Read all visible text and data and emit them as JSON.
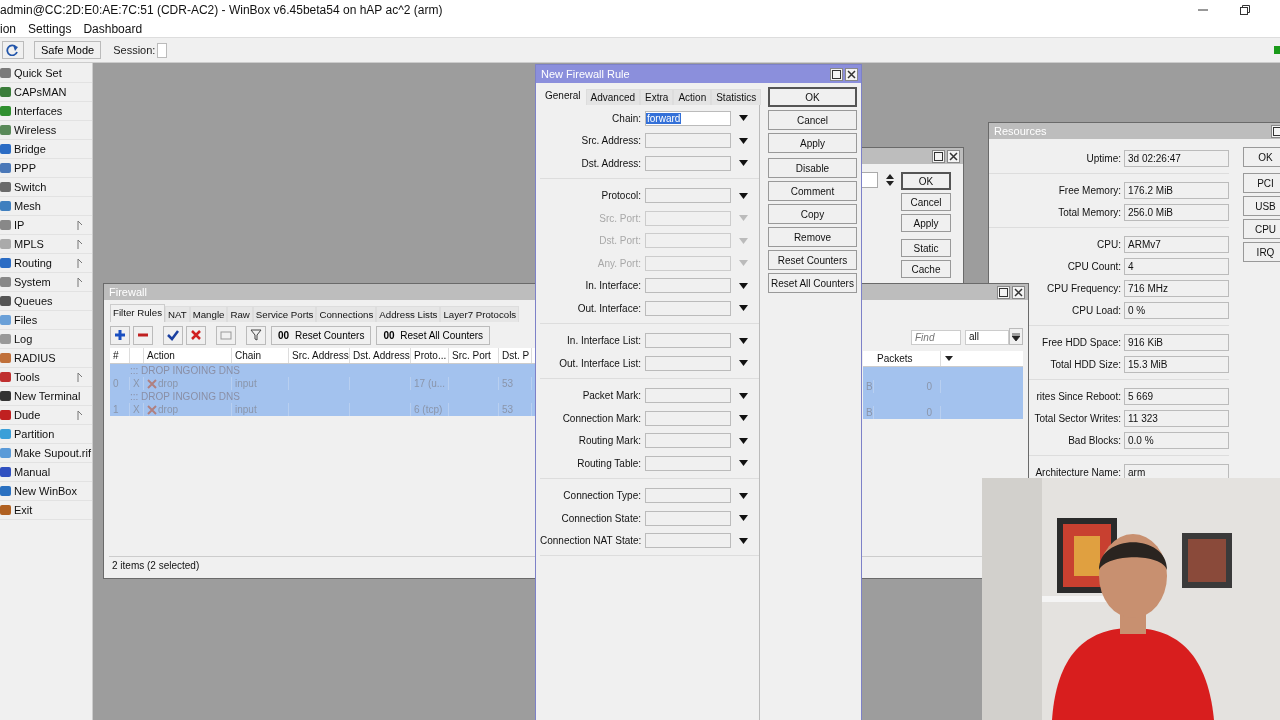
{
  "window": {
    "title": "admin@CC:2D:E0:AE:7C:51 (CDR-AC2) - WinBox v6.45beta54 on hAP ac^2 (arm)"
  },
  "menu": [
    "ion",
    "Settings",
    "Dashboard"
  ],
  "toolbar": {
    "safe_mode": "Safe Mode",
    "session_label": "Session:"
  },
  "sidebar": {
    "items": [
      {
        "label": "Quick Set",
        "submenu": false
      },
      {
        "label": "CAPsMAN",
        "submenu": false
      },
      {
        "label": "Interfaces",
        "submenu": false
      },
      {
        "label": "Wireless",
        "submenu": false
      },
      {
        "label": "Bridge",
        "submenu": false
      },
      {
        "label": "PPP",
        "submenu": false
      },
      {
        "label": "Switch",
        "submenu": false
      },
      {
        "label": "Mesh",
        "submenu": false
      },
      {
        "label": "IP",
        "submenu": true
      },
      {
        "label": "MPLS",
        "submenu": true
      },
      {
        "label": "Routing",
        "submenu": true
      },
      {
        "label": "System",
        "submenu": true
      },
      {
        "label": "Queues",
        "submenu": false
      },
      {
        "label": "Files",
        "submenu": false
      },
      {
        "label": "Log",
        "submenu": false
      },
      {
        "label": "RADIUS",
        "submenu": false
      },
      {
        "label": "Tools",
        "submenu": true
      },
      {
        "label": "New Terminal",
        "submenu": false
      },
      {
        "label": "Dude",
        "submenu": true
      },
      {
        "label": "Partition",
        "submenu": false
      },
      {
        "label": "Make Supout.rif",
        "submenu": false
      },
      {
        "label": "Manual",
        "submenu": false
      },
      {
        "label": "New WinBox",
        "submenu": false
      },
      {
        "label": "Exit",
        "submenu": false
      }
    ]
  },
  "back_window": {
    "buttons": [
      "OK",
      "Cancel",
      "Apply",
      "Static",
      "Cache"
    ]
  },
  "firewall": {
    "title": "Firewall",
    "tabs": [
      {
        "label": "Filter Rules",
        "selected": true
      },
      {
        "label": "NAT",
        "selected": false
      },
      {
        "label": "Mangle",
        "selected": false
      },
      {
        "label": "Raw",
        "selected": false
      },
      {
        "label": "Service Ports",
        "selected": false
      },
      {
        "label": "Connections",
        "selected": false
      },
      {
        "label": "Address Lists",
        "selected": false
      },
      {
        "label": "Layer7 Protocols",
        "selected": false
      }
    ],
    "counter_buttons": [
      {
        "glyph": "00",
        "label": "Reset Counters"
      },
      {
        "glyph": "00",
        "label": "Reset All Counters"
      }
    ],
    "columns": [
      "#",
      "Action",
      "Chain",
      "Src. Address",
      "Dst. Address",
      "Proto...",
      "Src. Port",
      "Dst. P"
    ],
    "find": {
      "placeholder": "Find"
    },
    "filter": "all",
    "right_columns": [
      "Packets"
    ],
    "rows": [
      {
        "kind": "comment",
        "text": "::: DROP INGOING DNS",
        "selected": true
      },
      {
        "kind": "rule",
        "number": "0",
        "flag": "X",
        "action": "drop",
        "chain": "input",
        "protocol": "17 (u...",
        "dst_port": "53",
        "bytes": "B",
        "packets": "0",
        "disabled": true,
        "selected": true
      },
      {
        "kind": "comment",
        "text": "::: DROP INGOING DNS",
        "selected": true
      },
      {
        "kind": "rule",
        "number": "1",
        "flag": "X",
        "action": "drop",
        "chain": "input",
        "protocol": "6 (tcp)",
        "dst_port": "53",
        "bytes": "B",
        "packets": "0",
        "disabled": true,
        "selected": true
      }
    ],
    "status": "2 items (2 selected)"
  },
  "dialog": {
    "title": "New Firewall Rule",
    "tabs": [
      {
        "label": "General",
        "selected": true
      },
      {
        "label": "Advanced",
        "selected": false
      },
      {
        "label": "Extra",
        "selected": false
      },
      {
        "label": "Action",
        "selected": false
      },
      {
        "label": "Statistics",
        "selected": false
      }
    ],
    "groups": [
      [
        {
          "label": "Chain:",
          "value": "forward",
          "value_selected": true,
          "disabled": false
        },
        {
          "label": "Src. Address:",
          "disabled": false
        },
        {
          "label": "Dst. Address:",
          "disabled": false
        }
      ],
      [
        {
          "label": "Protocol:",
          "disabled": false
        },
        {
          "label": "Src. Port:",
          "disabled": true
        },
        {
          "label": "Dst. Port:",
          "disabled": true
        },
        {
          "label": "Any. Port:",
          "disabled": true
        },
        {
          "label": "In. Interface:",
          "disabled": false
        },
        {
          "label": "Out. Interface:",
          "disabled": false
        }
      ],
      [
        {
          "label": "In. Interface List:",
          "disabled": false
        },
        {
          "label": "Out. Interface List:",
          "disabled": false
        }
      ],
      [
        {
          "label": "Packet Mark:",
          "disabled": false
        },
        {
          "label": "Connection Mark:",
          "disabled": false
        },
        {
          "label": "Routing Mark:",
          "disabled": false
        },
        {
          "label": "Routing Table:",
          "disabled": false
        }
      ],
      [
        {
          "label": "Connection Type:",
          "disabled": false
        },
        {
          "label": "Connection State:",
          "disabled": false
        },
        {
          "label": "Connection NAT State:",
          "disabled": false
        }
      ]
    ],
    "buttons": [
      [
        "OK",
        "Cancel",
        "Apply"
      ],
      [
        "Disable",
        "Comment",
        "Copy",
        "Remove",
        "Reset Counters",
        "Reset All Counters"
      ]
    ]
  },
  "resources": {
    "title": "Resources",
    "groups": [
      [
        {
          "label": "Uptime:",
          "value": "3d 02:26:47"
        }
      ],
      [
        {
          "label": "Free Memory:",
          "value": "176.2 MiB"
        },
        {
          "label": "Total Memory:",
          "value": "256.0 MiB"
        }
      ],
      [
        {
          "label": "CPU:",
          "value": "ARMv7"
        },
        {
          "label": "CPU Count:",
          "value": "4"
        },
        {
          "label": "CPU Frequency:",
          "value": "716 MHz"
        },
        {
          "label": "CPU Load:",
          "value": "0 %"
        }
      ],
      [
        {
          "label": "Free HDD Space:",
          "value": "916 KiB"
        },
        {
          "label": "Total HDD Size:",
          "value": "15.3 MiB"
        }
      ],
      [
        {
          "label": "rites Since Reboot:",
          "value": "5 669"
        },
        {
          "label": "Total Sector Writes:",
          "value": "11 323"
        },
        {
          "label": "Bad Blocks:",
          "value": "0.0 %"
        }
      ],
      [
        {
          "label": "Architecture Name:",
          "value": "arm"
        }
      ]
    ],
    "buttons": [
      [
        "OK"
      ],
      [
        "PCI",
        "USB",
        "CPU",
        "IRQ"
      ]
    ]
  },
  "webcam": {
    "kind": "picture"
  }
}
